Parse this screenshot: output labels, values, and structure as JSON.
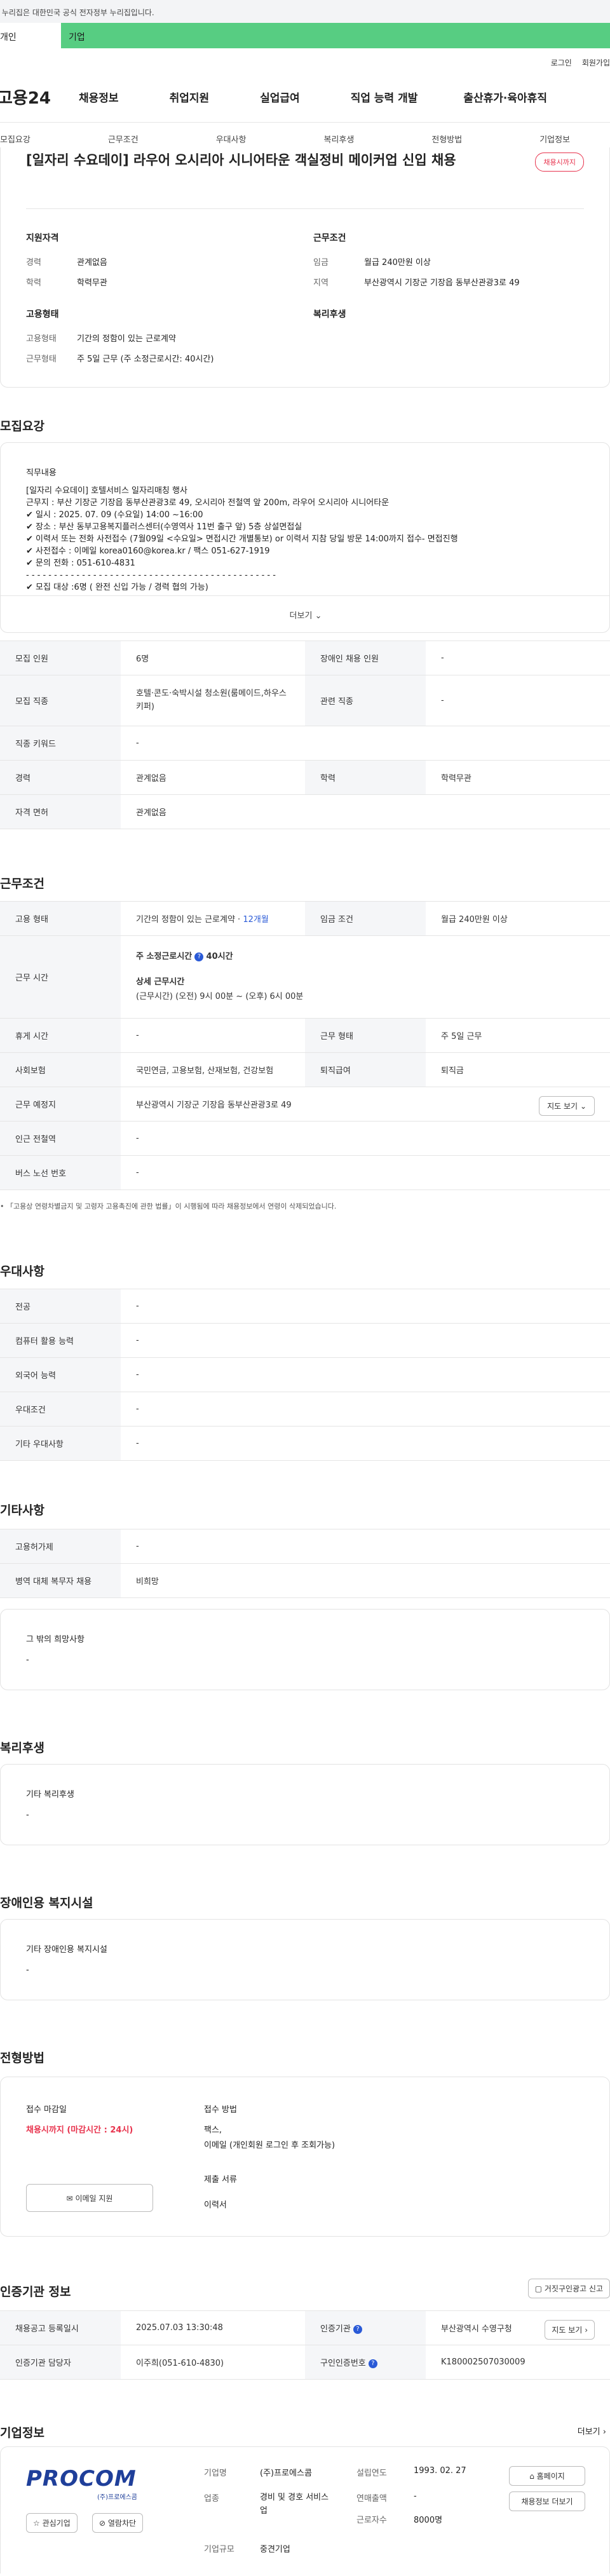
{
  "gov_banner": "이 누리집은 대한민국 공식 전자정부 누리집입니다.",
  "top_tabs": {
    "personal": "개인",
    "company": "기업"
  },
  "util": {
    "login": "로그인",
    "join": "회원가입"
  },
  "logo": "고용24",
  "gnb": [
    "채용정보",
    "취업지원",
    "실업급여",
    "직업 능력 개발",
    "출산휴가·육아휴직"
  ],
  "anchors": [
    "모집요강",
    "근무조건",
    "우대사항",
    "복리후생",
    "전형방법",
    "기업정보"
  ],
  "summary": {
    "badge": "채용시까지",
    "title": "[일자리 수요데이] 라우어 오시리아 시니어타운 객실정비 메이커업 신입 채용",
    "qual_heading": "지원자격",
    "cond_heading": "근무조건",
    "type_heading": "고용형태",
    "welfare_heading": "복리후생",
    "career_lbl": "경력",
    "career_val": "관계없음",
    "edu_lbl": "학력",
    "edu_val": "학력무관",
    "wage_lbl": "임금",
    "wage_val": "월급 240만원 이상",
    "region_lbl": "지역",
    "region_val": "부산광역시 기장군 기장읍 동부산관광3로 49",
    "emp_type_lbl": "고용형태",
    "emp_type_val": "기간의 정함이 있는 근로계약",
    "work_form_lbl": "근무형태",
    "work_form_val": "주 5일 근무 (주 소정근로시간: 40시간)"
  },
  "recruit": {
    "heading": "모집요강",
    "duty_heading": "직무내용",
    "duty_lines": [
      "[일자리 수요데이] 호텔서비스 일자리매칭 행사",
      "근무지 : 부산 기장군 기장읍 동부산관광3로 49, 오시리아 전철역 앞 200m, 라우어 오시리아 시니어타운",
      "✔ 일시 : 2025. 07. 09 (수요일) 14:00 ~16:00",
      "✔ 장소 : 부산 동부고용복지플러스센터(수영역사 11번 출구 앞) 5층 상설면접실",
      "✔ 이력서 또는 전화 사전접수 (7월09일 <수요일> 면접시간 개별통보) or 이력서 지참 당일 방문 14:00까지 접수- 면접진행",
      "✔ 사전접수 : 이메일 korea0160@korea.kr / 팩스 051-627-1919",
      "✔ 문의 전화 : 051-610-4831",
      "- - - - - - - - - - - - - - - - - - - - - - - - - - - - - - - - - - - - - - - - - - - - -",
      "✔ 모집 대상 :6명 ( 완전 신입 가능 / 경력 협의 가능)"
    ],
    "more": "더보기",
    "count_lbl": "모집 인원",
    "count_val": "6명",
    "disabled_lbl": "장애인 채용 인원",
    "disabled_val": "-",
    "job_lbl": "모집 직종",
    "job_val": "호텔·콘도·숙박시설 청소원(룸메이드,하우스키퍼)",
    "related_lbl": "관련 직종",
    "related_val": "-",
    "keyword_lbl": "직종 키워드",
    "keyword_val": "-",
    "career_lbl": "경력",
    "career_val": "관계없음",
    "edu_lbl": "학력",
    "edu_val": "학력무관",
    "license_lbl": "자격 면허",
    "license_val": "관계없음"
  },
  "work": {
    "heading": "근무조건",
    "type_lbl": "고용 형태",
    "type_val": "기간의 정함이 있는 근로계약 · ",
    "type_months": "12개월",
    "wage_lbl": "임금 조건",
    "wage_val": "월급 240만원 이상",
    "hours_lbl": "근무 시간",
    "hours_weekly": "주 소정근로시간",
    "hours_weekly_val": "40시간",
    "hours_detail_h": "상세 근무시간",
    "hours_detail": "(근무시간) (오전) 9시 00분 ~ (오후) 6시 00분",
    "rest_lbl": "휴게 시간",
    "rest_val": "-",
    "form_lbl": "근무 형태",
    "form_val": "주 5일 근무",
    "ins_lbl": "사회보험",
    "ins_val": "국민연금, 고용보험, 산재보험, 건강보험",
    "sev_lbl": "퇴직급여",
    "sev_val": "퇴직금",
    "place_lbl": "근무 예정지",
    "place_val": "부산광역시 기장군 기장읍 동부산관광3로 49",
    "map_btn": "지도 보기",
    "subway_lbl": "인근 전철역",
    "subway_val": "-",
    "bus_lbl": "버스 노선 번호",
    "bus_val": "-",
    "note": "「고용상 연령차별금지 및 고령자 고용촉진에 관한 법률」이 시행됨에 따라 채용정보에서 연령이 삭제되었습니다."
  },
  "pref": {
    "heading": "우대사항",
    "rows": [
      {
        "lbl": "전공",
        "val": "-"
      },
      {
        "lbl": "컴퓨터 활용 능력",
        "val": "-"
      },
      {
        "lbl": "외국어 능력",
        "val": "-"
      },
      {
        "lbl": "우대조건",
        "val": "-"
      },
      {
        "lbl": "기타 우대사항",
        "val": "-"
      }
    ]
  },
  "etc": {
    "heading": "기타사항",
    "emp_lbl": "고용허가제",
    "emp_val": "-",
    "mil_lbl": "병역 대체 복무자 채용",
    "mil_val": "비희망",
    "other_h": "그 밖의 희망사항",
    "other_val": "-"
  },
  "welfare": {
    "heading": "복리후생",
    "sub_h": "기타 복리후생",
    "val": "-"
  },
  "disabled": {
    "heading": "장애인용 복지시설",
    "sub_h": "기타 장애인용 복지시설",
    "val": "-"
  },
  "selection": {
    "heading": "전형방법",
    "deadline_h": "접수 마감일",
    "deadline_val": "채용시까지 (마감시간 : 24시)",
    "method_h": "접수 방법",
    "method_val1": "팩스,",
    "method_val2": "이메일 (개인회원 로그인 후 조회가능)",
    "docs_h": "제출 서류",
    "docs_val": "이력서",
    "email_btn": "이메일 지원"
  },
  "cert": {
    "heading": "인증기관 정보",
    "report_btn": "거짓구인광고 신고",
    "reg_lbl": "채용공고 등록일시",
    "reg_val": "2025.07.03 13:30:48",
    "org_lbl": "인증기관",
    "org_val": "부산광역시 수영구청",
    "mgr_lbl": "인증기관 담당자",
    "mgr_val": "이주희(051-610-4830)",
    "num_lbl": "구인인증번호",
    "num_val": "K180002507030009",
    "map_btn": "지도 보기"
  },
  "company": {
    "heading": "기업정보",
    "more": "더보기",
    "logo_text": "PROCOM",
    "logo_sub": "(주)프로에스콤",
    "name_lbl": "기업명",
    "name_val": "(주)프로에스콤",
    "founded_lbl": "설립연도",
    "founded_val": "1993. 02. 27",
    "industry_lbl": "업종",
    "industry_val": "경비 및 경호 서비스업",
    "revenue_lbl": "연매출액",
    "revenue_val": "-",
    "emp_lbl": "근로자수",
    "emp_val": "8000명",
    "size_lbl": "기업규모",
    "size_val": "중견기업",
    "fav_btn": "관심기업",
    "block_btn": "열람차단",
    "home_btn": "홈페이지",
    "info_btn": "채용정보 더보기"
  },
  "colors": {
    "accent_green": "#57cd82",
    "deadline_red": "#e8344e",
    "link_blue": "#2a5ad7"
  }
}
